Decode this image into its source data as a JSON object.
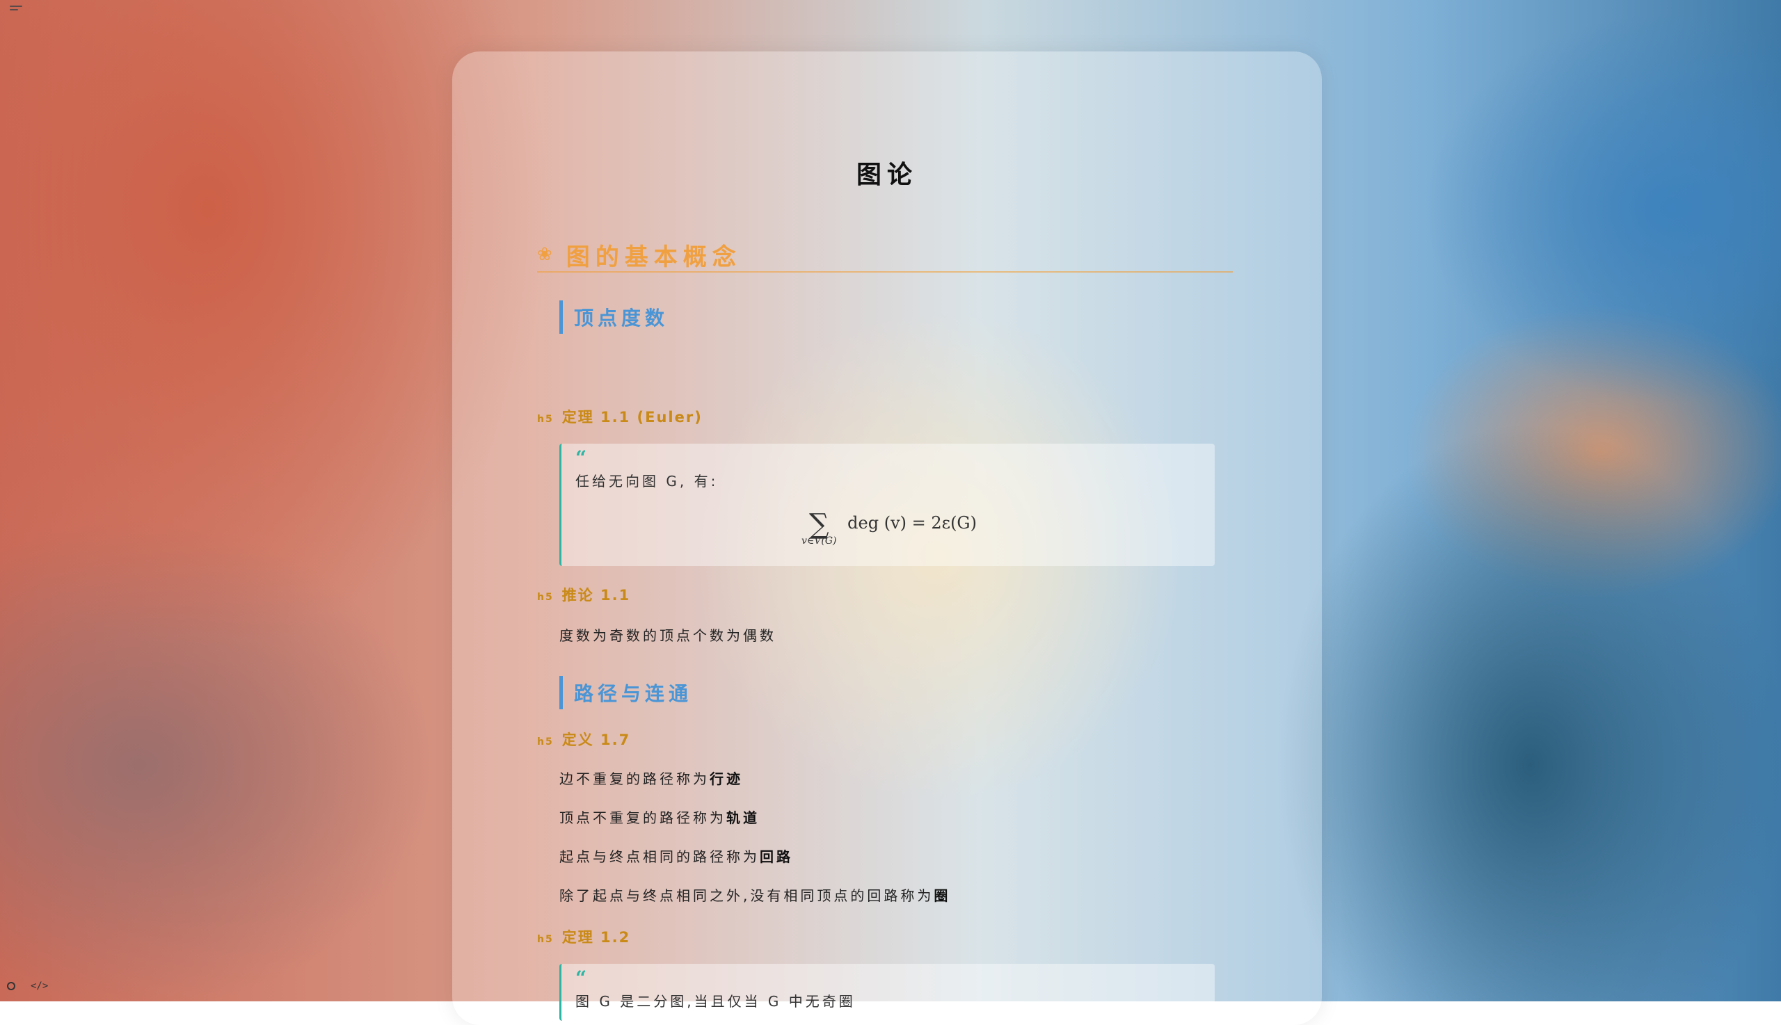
{
  "page": {
    "title": "图论"
  },
  "sections": [
    {
      "heading": "图的基本概念",
      "icon": "flower-icon",
      "subsections": [
        {
          "heading": "顶点度数",
          "blocks": [
            {
              "type": "h5",
              "tag": "h5",
              "text": "定理 1.1 (Euler)"
            },
            {
              "type": "quote",
              "text": "任给无向图 G, 有:",
              "formula": {
                "sum_sub": "v∈V(G)",
                "body": "deg (v) = 2ε(G)"
              }
            },
            {
              "type": "h5",
              "tag": "h5",
              "text": "推论 1.1"
            },
            {
              "type": "para",
              "text": "度数为奇数的顶点个数为偶数"
            }
          ]
        },
        {
          "heading": "路径与连通",
          "blocks": [
            {
              "type": "h5",
              "tag": "h5",
              "text": "定义 1.7"
            },
            {
              "type": "para",
              "prefix": "边不重复的路径称为",
              "bold": "行迹"
            },
            {
              "type": "para",
              "prefix": "顶点不重复的路径称为",
              "bold": "轨道"
            },
            {
              "type": "para",
              "prefix": "起点与终点相同的路径称为",
              "bold": "回路"
            },
            {
              "type": "para",
              "prefix": "除了起点与终点相同之外,没有相同顶点的回路称为",
              "bold": "圈"
            },
            {
              "type": "h5",
              "tag": "h5",
              "text": "定理 1.2"
            },
            {
              "type": "quote",
              "text": "图 G 是二分图,当且仅当 G 中无奇圈"
            }
          ]
        }
      ]
    }
  ],
  "chrome": {
    "menu_icon": "hamburger-menu-icon",
    "bottom_left_icons": [
      "circle-icon",
      "code-icon"
    ],
    "code_glyph": "</>"
  },
  "colors": {
    "h2": "#f0a040",
    "h3": "#4a95d6",
    "h5": "#c98a18",
    "quote_border": "#2ab5a5"
  }
}
